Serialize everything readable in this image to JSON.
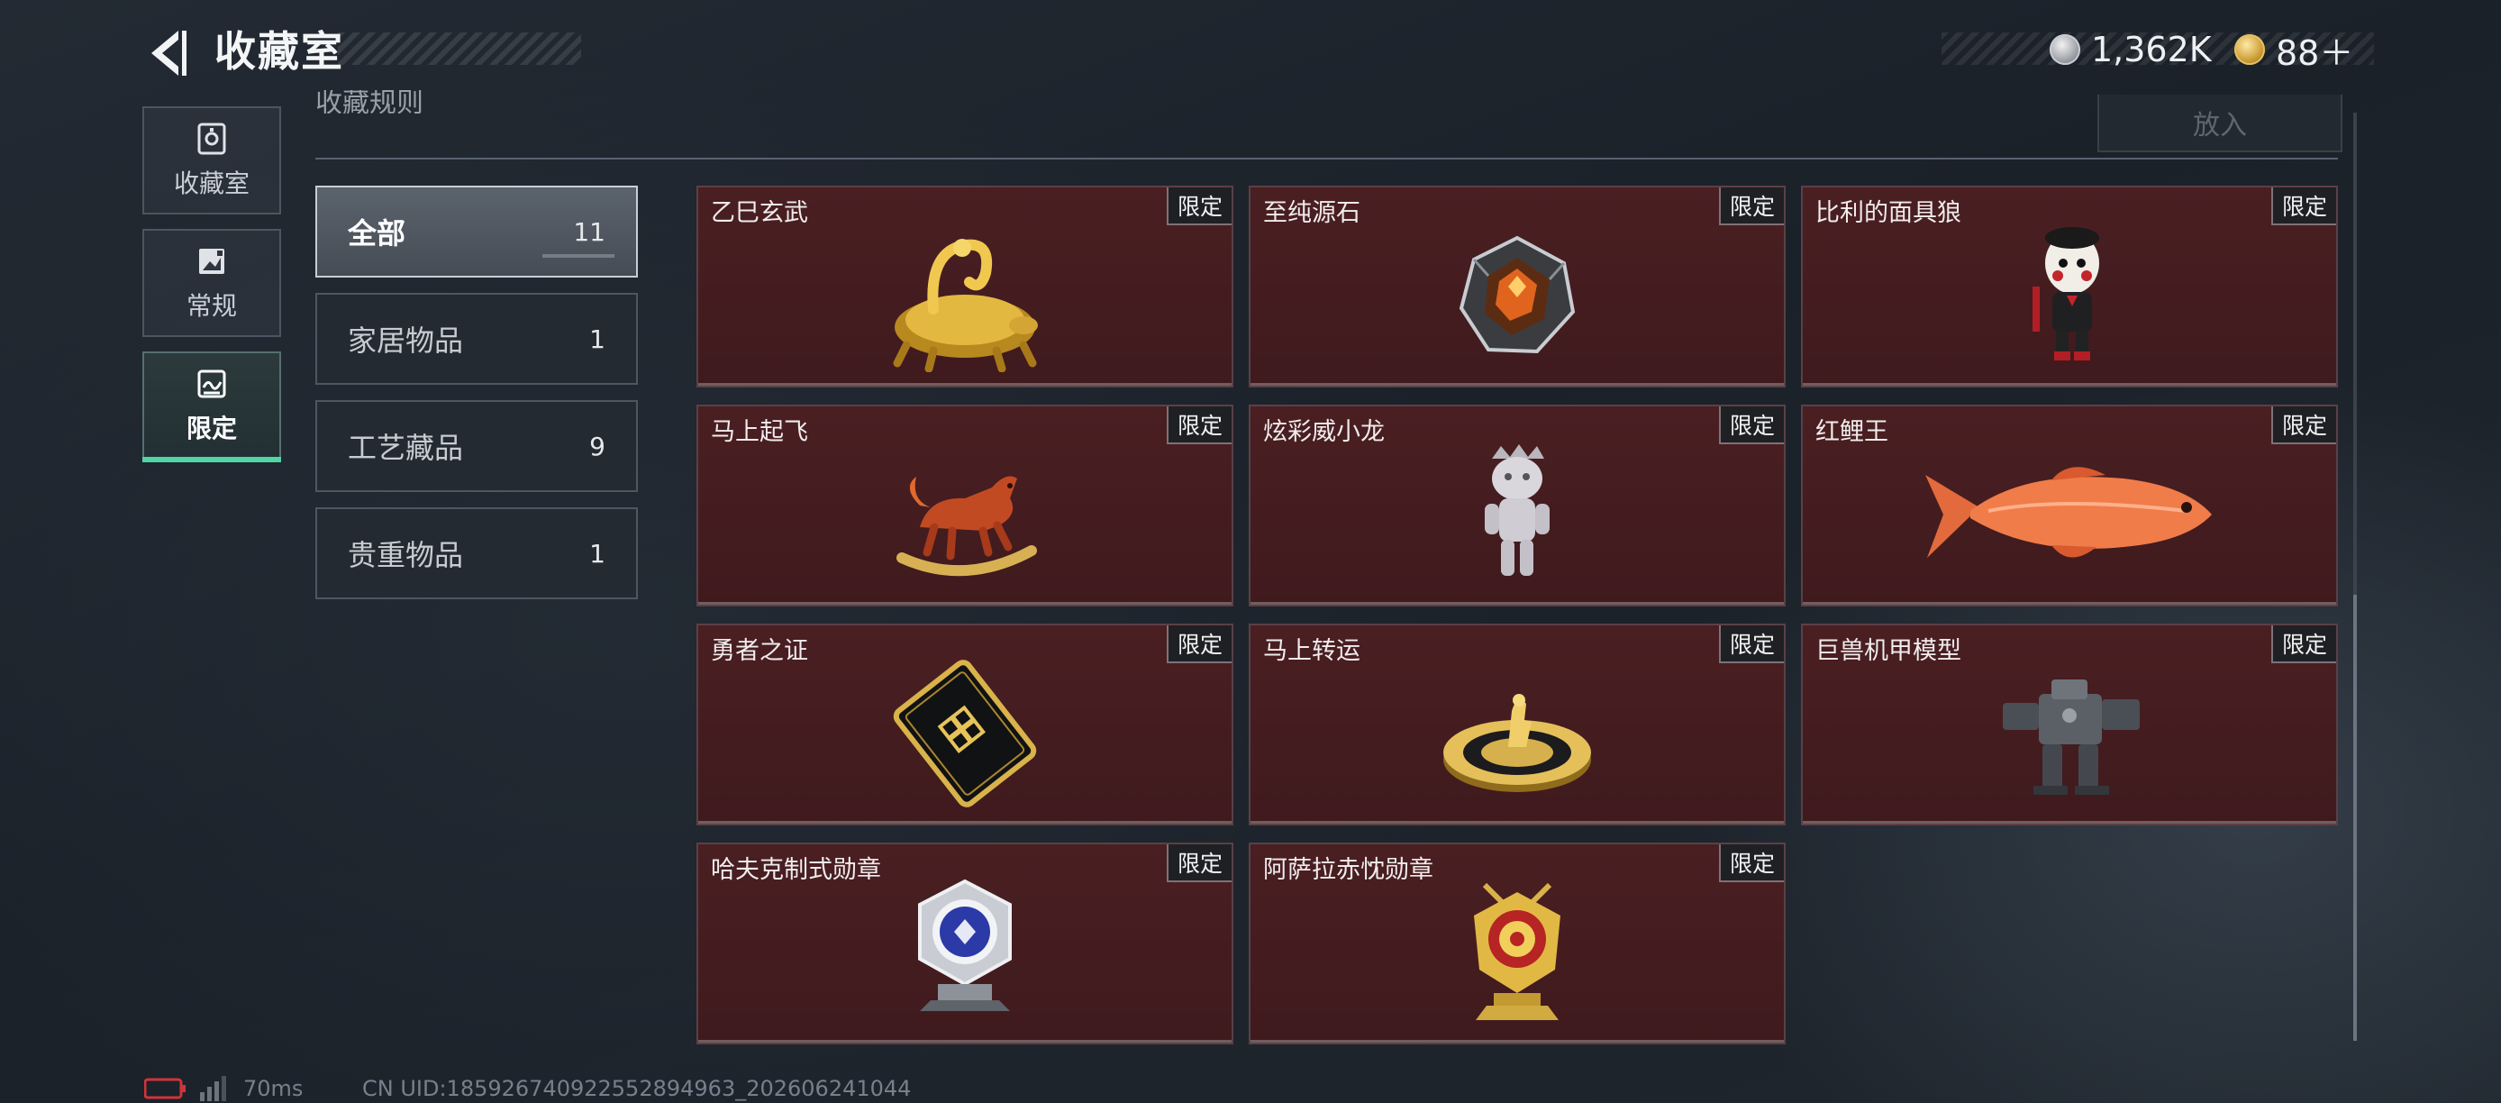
{
  "header": {
    "title": "收藏室",
    "currencies": [
      {
        "icon": "silver-coin-icon",
        "value": "1,362K"
      },
      {
        "icon": "gold-coin-icon",
        "value": "88＋"
      }
    ]
  },
  "toolbar": {
    "partial_label": "收藏规则",
    "put_in_label": "放入"
  },
  "rail": [
    {
      "label": "收藏室",
      "icon": "collection-room-icon",
      "active": false
    },
    {
      "label": "常规",
      "icon": "regular-icon",
      "active": false
    },
    {
      "label": "限定",
      "icon": "limited-icon",
      "active": true
    }
  ],
  "categories": [
    {
      "label": "全部",
      "count": "11",
      "active": true
    },
    {
      "label": "家居物品",
      "count": "1",
      "active": false
    },
    {
      "label": "工艺藏品",
      "count": "9",
      "active": false
    },
    {
      "label": "贵重物品",
      "count": "1",
      "active": false
    }
  ],
  "items": [
    {
      "name": "乙巳玄武",
      "tag": "限定",
      "icon": "golden-snake-tortoise-icon"
    },
    {
      "name": "至纯源石",
      "tag": "限定",
      "icon": "source-stone-icon"
    },
    {
      "name": "比利的面具狼",
      "tag": "限定",
      "icon": "billy-puppet-icon"
    },
    {
      "name": "马上起飞",
      "tag": "限定",
      "icon": "rocking-horse-icon"
    },
    {
      "name": "炫彩威小龙",
      "tag": "限定",
      "icon": "dragon-figure-icon"
    },
    {
      "name": "红鲤王",
      "tag": "限定",
      "icon": "red-carp-icon"
    },
    {
      "name": "勇者之证",
      "tag": "限定",
      "icon": "hero-card-icon"
    },
    {
      "name": "马上转运",
      "tag": "限定",
      "icon": "fortune-wheel-icon"
    },
    {
      "name": "巨兽机甲模型",
      "tag": "限定",
      "icon": "mech-model-icon"
    },
    {
      "name": "哈夫克制式勋章",
      "tag": "限定",
      "icon": "haavk-medal-icon"
    },
    {
      "name": "阿萨拉赤忱勋章",
      "tag": "限定",
      "icon": "asala-medal-icon"
    }
  ],
  "footer": {
    "ping": "70ms",
    "uid": "CN UID:185926740922552894963_202606241044"
  },
  "colors": {
    "accent": "#4fd6a4",
    "card_bg": "#451d20",
    "tag_bg": "#1f2024"
  }
}
